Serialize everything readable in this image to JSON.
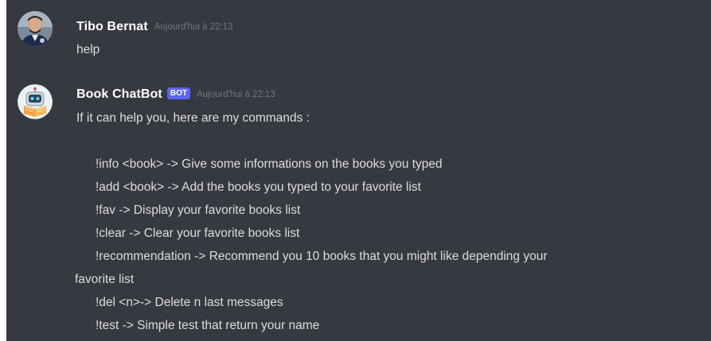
{
  "messages": [
    {
      "author": "Tibo Bernat",
      "timestamp": "Aujourd'hui à 22:13",
      "text": "help"
    },
    {
      "author": "Book ChatBot",
      "badge": "BOT",
      "timestamp": "Aujourd'hui à 22:13",
      "intro": "If it can help you, here are my commands :",
      "commands": [
        "!info <book> -> Give some informations on the books you typed",
        "!add <book> -> Add the books you typed to your favorite list",
        "!fav -> Display your favorite books list",
        "!clear -> Clear your favorite books list",
        "!recommendation -> Recommend you 10 books that you might like depending your",
        "favorite list",
        "!del <n>-> Delete n last messages",
        "!test -> Simple test that return your name"
      ]
    }
  ],
  "colors": {
    "background": "#36393f",
    "username": "#ffffff",
    "message_text": "#dcddde",
    "timestamp": "#72767d",
    "bot_badge": "#5865f2"
  }
}
